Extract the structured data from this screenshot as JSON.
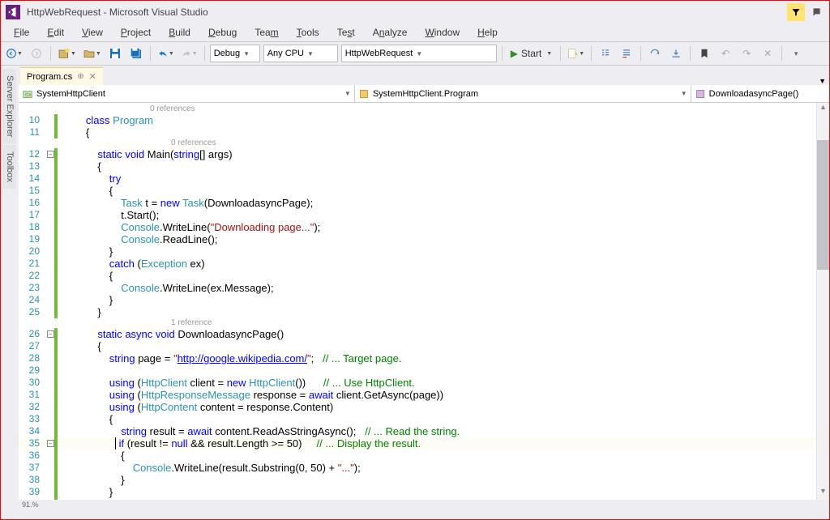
{
  "title": "HttpWebRequest - Microsoft Visual Studio",
  "menu": [
    "File",
    "Edit",
    "View",
    "Project",
    "Build",
    "Debug",
    "Team",
    "Tools",
    "Test",
    "Analyze",
    "Window",
    "Help"
  ],
  "toolbar": {
    "config": "Debug",
    "platform": "Any CPU",
    "startup": "HttpWebRequest",
    "start": "Start"
  },
  "left_tabs": [
    "Server Explorer",
    "Toolbox"
  ],
  "tab": {
    "name": "Program.cs"
  },
  "nav": {
    "project": "SystemHttpClient",
    "class": "SystemHttpClient.Program",
    "method": "DownloadasyncPage()"
  },
  "refs": {
    "zero": "0 references",
    "one": "1 reference"
  },
  "code_lines": {
    "l10": "class Program",
    "l14": "try",
    "l16_t": "Task t = new Task(DownloadasyncPage);",
    "l17": "t.Start();",
    "l18_a": "Console.WriteLine(",
    "l18_s": "\"Downloading page...\"",
    "l19": "Console.ReadLine();",
    "l21": "catch (Exception ex)",
    "l23": "Console.WriteLine(ex.Message);",
    "l26": "static async void DownloadasyncPage()",
    "l28_a": "string page = ",
    "l28_u": "\"http://google.wikipedia.com/\"",
    "l28_c": "// ... Target page.",
    "l30_a": "using (HttpClient client = new HttpClient())",
    "l30_c": "// ... Use HttpClient.",
    "l31": "using (HttpResponseMessage response = await client.GetAsync(page))",
    "l32": "using (HttpContent content = response.Content)",
    "l34_a": "string result = await content.ReadAsStringAsync();",
    "l34_c": "// ... Read the string.",
    "l35_a": "if (result != null && result.Length >= 50)",
    "l35_c": "// ... Display the result.",
    "l37_a": "Console.WriteLine(result.Substring(0, 50) + ",
    "l37_s": "\"...\""
  },
  "status": {
    "zoom": "91.%"
  }
}
